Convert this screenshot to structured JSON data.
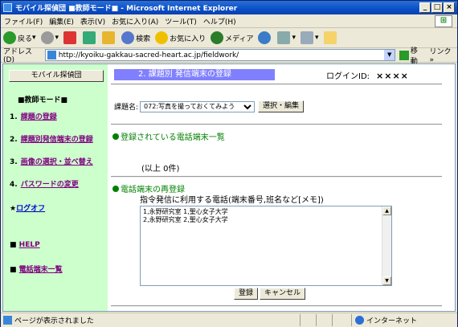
{
  "window": {
    "title": "モバイル探偵団 ■教師モード■ - Microsoft Internet Explorer",
    "controls": [
      "_",
      "□",
      "×"
    ]
  },
  "menu": [
    "ファイル(F)",
    "編集(E)",
    "表示(V)",
    "お気に入り(A)",
    "ツール(T)",
    "ヘルプ(H)"
  ],
  "toolbar": {
    "back": "戻る",
    "search": "検索",
    "favorites": "お気に入り",
    "media": "メディア"
  },
  "address": {
    "label": "アドレス(D)",
    "url": "http://kyoiku-gakkau-sacred-heart.ac.jp/fieldwork/",
    "go": "移動",
    "links": "リンク »"
  },
  "sidebar": {
    "top_button": "モバイル探偵団",
    "mode_label": "■教師モード■",
    "items": [
      {
        "num": "1.",
        "label": "課題の登録"
      },
      {
        "num": "2.",
        "label": "課題別発信端末の登録"
      },
      {
        "num": "3.",
        "label": "画像の選択・並べ替え"
      },
      {
        "num": "4.",
        "label": "パスワードの変更"
      }
    ],
    "logoff_prefix": "★",
    "logoff": "ログオフ",
    "help_prefix": "■",
    "help": "HELP",
    "phone_prefix": "■",
    "phone_list": "電話端末一覧"
  },
  "main": {
    "title": "2. 課題別 発信端末の登録",
    "login_label": "ログインID:",
    "login_value": "××××",
    "topic_label": "課題名:",
    "topic_selected": "072:写真を撮っておくてみよう",
    "select_edit_button": "選択・編集",
    "registered_heading": "登録されている電話端末一覧",
    "registered_count": "(以上 0件)",
    "reregister_heading": "電話端末の再登録",
    "memo_note": "指令発信に利用する電話(端末番号,班名など[メモ])",
    "memo_lines": [
      "1,永野研究室 1,聖心女子大学",
      "2,永野研究室 2,聖心女子大学"
    ],
    "register_button": "登録",
    "cancel_button": "キャンセル"
  },
  "status": {
    "text": "ページが表示されました",
    "zone": "インターネット"
  }
}
